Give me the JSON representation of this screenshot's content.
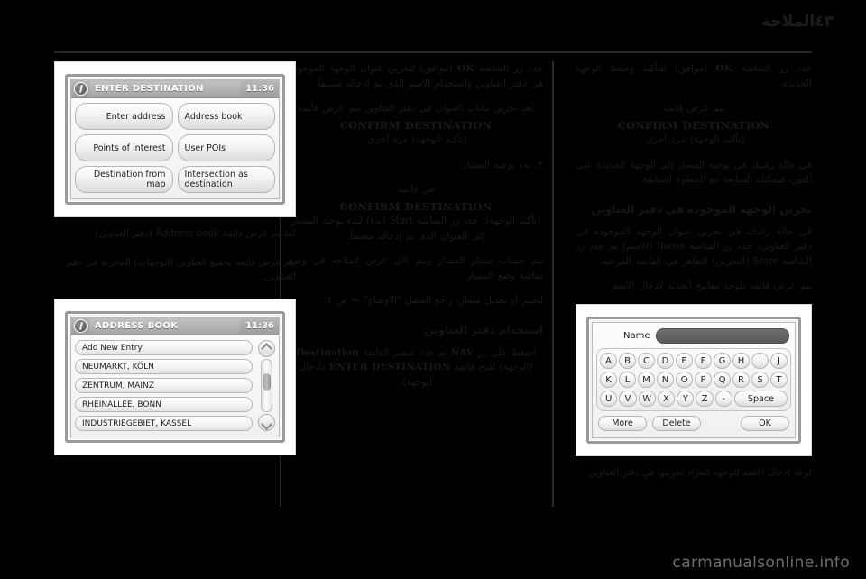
{
  "header": {
    "title": "الملاحة",
    "page_number": "٤٣"
  },
  "screens": {
    "enter_destination": {
      "title": "ENTER DESTINATION",
      "clock": "11:36",
      "buttons": [
        "Enter address",
        "Address book",
        "Points of interest",
        "User POIs",
        "Destination from map",
        "Intersection as destination"
      ]
    },
    "address_book": {
      "title": "ADDRESS BOOK",
      "clock": "11:36",
      "items": [
        "Add New Entry",
        "NEUMARKT, KÖLN",
        "ZENTRUM, MAINZ",
        "RHEINALLEE, BONN",
        "INDUSTRIEGEBIET, KASSEL"
      ],
      "scroll_up_icon": "chevron-up-icon",
      "scroll_down_icon": "chevron-down-icon"
    },
    "name_keyboard": {
      "field_label": "Name",
      "field_value": "",
      "rows": [
        [
          "A",
          "B",
          "C",
          "D",
          "E",
          "F",
          "G",
          "H",
          "I",
          "J"
        ],
        [
          "K",
          "L",
          "M",
          "N",
          "O",
          "P",
          "Q",
          "R",
          "S",
          "T"
        ],
        [
          "U",
          "V",
          "W",
          "X",
          "Y",
          "Z",
          "-"
        ]
      ],
      "space_key": "Space",
      "more_button": "More",
      "delete_button": "Delete",
      "ok_button": "OK"
    }
  },
  "left_column": {
    "caption_1": "لقد تم عرض قائمة Address book (دفتر العناوين).",
    "caption_2": "يتم عرض قائمة بجميع العناوين (الوجهات) المخزنة في دفتر العناوين."
  },
  "middle_column": {
    "para_1_pre": "حدد زر الشاشة ",
    "para_1_term": "OK",
    "para_1_post": " (موافق) لتخزين عنوان الوجهة الموجودة في دفتر العناوين واستخدام الاسم الذي تم إدخاله مسبقاً.",
    "para_2": "بعد تخزين بيانات العنوان في دفتر العناوين يتم عرض قائمة",
    "para_2_term": "CONFIRM DESTINATION",
    "para_2_post": "(تأكيد الوجهة) مرة أخرى.",
    "list_item_3": "٣. بدء توجيه المسار:",
    "para_3": "في قائمة",
    "para_3_term": "CONFIRM DESTINATION",
    "para_3_post": "(تأكيد الوجهة): حدد زر الشاشة Start (بدء) لبدء توجيه المسار إلى العنوان الذي تم إدخاله مسبقاً.",
    "para_4": "يتم حساب مسار المسار ويتم الآن عرض الملاحة في وضع شاشة وضع المسار.",
    "para_5": "لتغيير أو تعديل مسار، راجع الفصل \"الأوضاع\" ⇔ ص ٤.",
    "sub_head": "استخدام دفتر العناوين",
    "para_6_pre": "اضغط على زر ",
    "para_6_term": "NAV",
    "para_6_mid": " ثم حدد عنصر القائمة ",
    "para_6_term2": "Destination",
    "para_6_mid2": " (الوجهة) لفتح قائمة ",
    "para_6_term3": "ENTER DESTINATION",
    "para_6_post": " (إدخال الوجهة)."
  },
  "right_column": {
    "para_1_pre": "حدد زر الشاشة ",
    "para_1_term": "OK",
    "para_1_post": " (موافق) للتأكيد وحفظ الوجهة الجديدة.",
    "para_2_pre": "يتم عرض قائمة ",
    "para_2_term": "CONFIRM DESTINATION",
    "para_2_post": " (تأكيد الوجهة) مرة أخرى.",
    "para_3": "في حالة رغبتك في توجيه المسار إلى الوجهة الجديدة على الفور، فيمكنك المتابعة مع الخطوة السابقة.",
    "sub_head": "تخزين الوجهة الموجودة في دفتر العناوين",
    "para_4": "في حالة رغبتك في تخزين عنوان الوجهة الموجودة في دفتر العناوين: حدد زر الشاشة Name (الاسم) ثم حدد زر الشاشة Store (التخزين) الظاهر في القائمة الفرعية.",
    "para_5": "يتم عرض قائمة بلوحة مفاتيح أبجدية لإدخال الاسم.",
    "caption": "لوحة إدخال الاسم للوجهة المراد تخزينها في دفتر العناوين"
  },
  "footer": {
    "watermark": "carmanualsonline.info"
  }
}
